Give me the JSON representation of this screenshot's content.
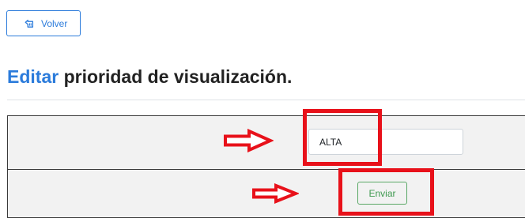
{
  "toolbar": {
    "back_label": "Volver",
    "back_icon": "back-hand-icon"
  },
  "page": {
    "title_accent": "Editar",
    "title_rest": "prioridad de visualización."
  },
  "form": {
    "priority_value": "ALTA",
    "submit_label": "Enviar"
  },
  "annotations": {
    "highlight_color": "#e8111a",
    "arrow_icon": "red-outline-right-arrow"
  },
  "colors": {
    "primary": "#2b7bdb",
    "success": "#5aa866",
    "table_bg": "#f2f2f2"
  }
}
